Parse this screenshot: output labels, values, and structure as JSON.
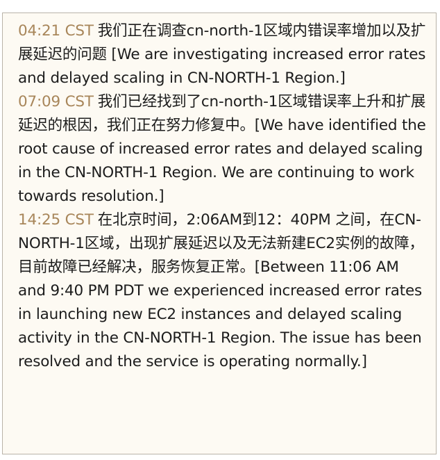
{
  "updates": [
    {
      "time": "04:21 CST",
      "message": "我们正在调查cn-north-1区域内错误率增加以及扩展延迟的问题 [We are investigating increased error rates and delayed scaling in CN-NORTH-1 Region.]"
    },
    {
      "time": "07:09 CST",
      "message": "我们已经找到了cn-north-1区域错误率上升和扩展延迟的根因，我们正在努力修复中。[We have identified the root cause of increased error rates and delayed scaling in the CN-NORTH-1 Region. We are continuing to work towards resolution.]"
    },
    {
      "time": "14:25 CST",
      "message": "在北京时间，2:06AM到12：40PM 之间，在CN-NORTH-1区域，出现扩展延迟以及无法新建EC2实例的故障，目前故障已经解决，服务恢复正常。[Between 11:06 AM and 9:40 PM PDT we experienced increased error rates in launching new EC2 instances and delayed scaling activity in the CN-NORTH-1 Region. The issue has been resolved and the service is operating normally.]"
    }
  ],
  "colors": {
    "timestamp": "#a8865a",
    "text": "#1c1c1c",
    "background": "#fdfaf3",
    "border": "#b9b3a8"
  }
}
